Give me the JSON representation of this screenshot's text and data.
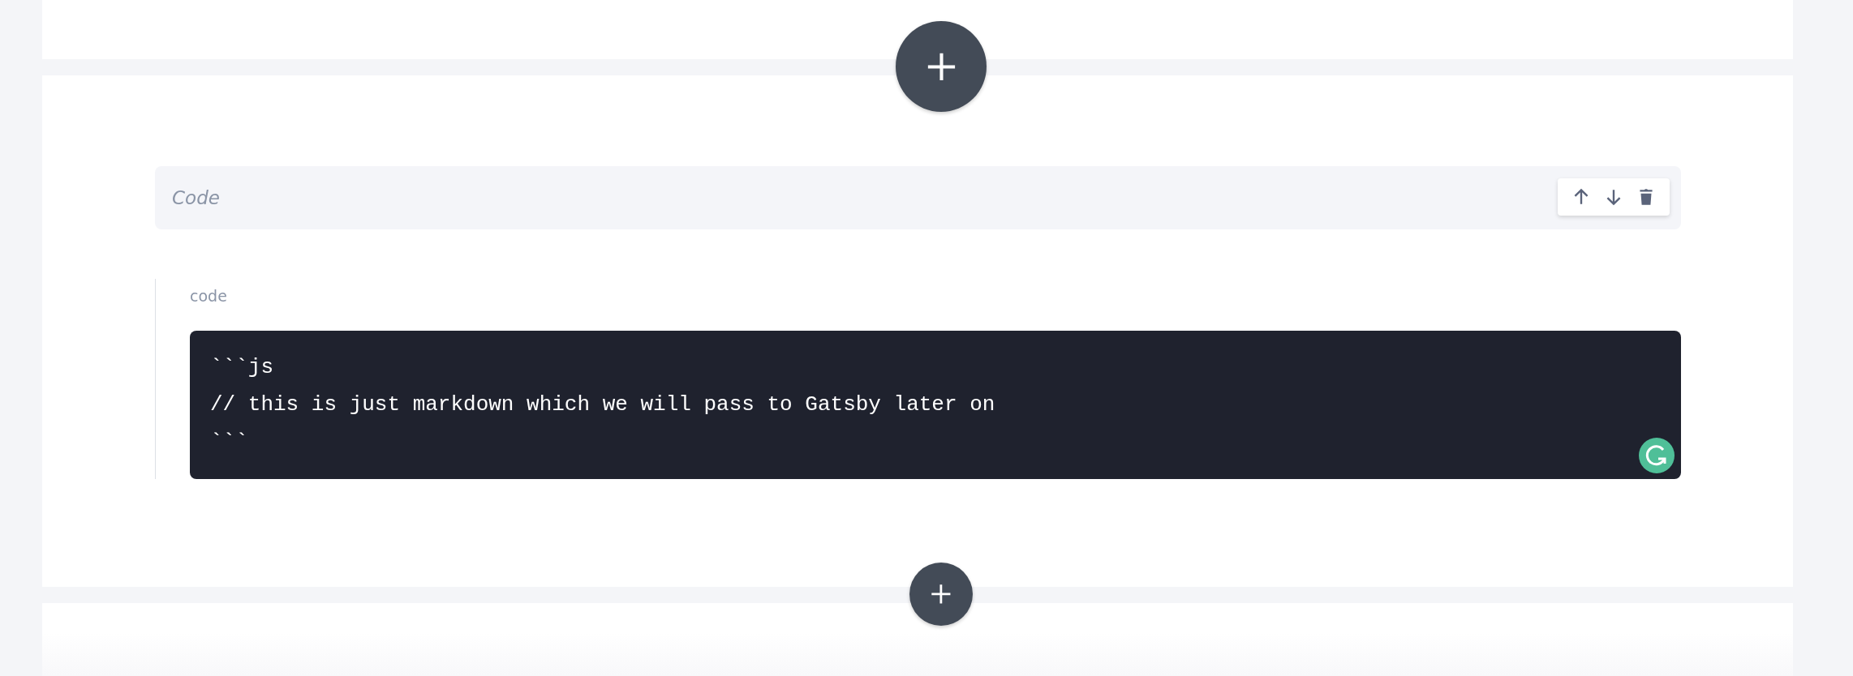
{
  "add_buttons": [
    {
      "kind": "large"
    },
    {
      "kind": "small"
    }
  ],
  "block": {
    "title_placeholder": "Code",
    "label": "code",
    "lines": [
      "```js",
      "// this is just markdown which we will pass to Gatsby later on",
      "```"
    ]
  }
}
